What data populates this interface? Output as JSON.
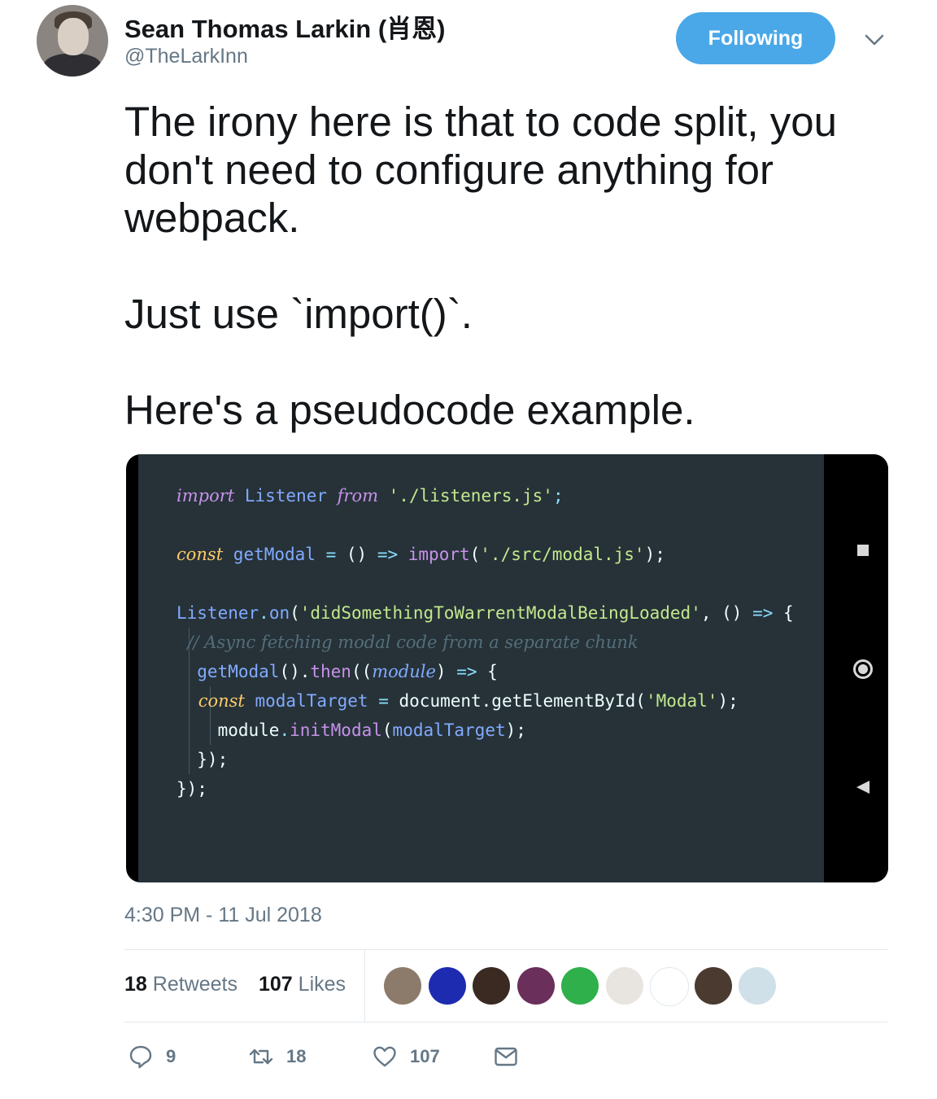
{
  "author": {
    "name": "Sean Thomas Larkin (肖恩)",
    "handle": "@TheLarkInn"
  },
  "follow_button": {
    "label": "Following",
    "color": "#4aa8e8"
  },
  "tweet": {
    "text": "The irony here is that to code split, you don't need to configure anything for webpack.\n\nJust use `import()`.\n\nHere's a pseudocode example.",
    "timestamp": "4:30 PM - 11 Jul 2018"
  },
  "code_image": {
    "lines": [
      [
        {
          "t": "import",
          "c": "kw"
        },
        {
          "t": " Listener ",
          "c": "ident"
        },
        {
          "t": "from",
          "c": "kw"
        },
        {
          "t": " './listeners.js'",
          "c": "str"
        },
        {
          "t": ";",
          "c": "op"
        }
      ],
      [],
      [
        {
          "t": "const",
          "c": "const-kw"
        },
        {
          "t": " getModal",
          "c": "fn"
        },
        {
          "t": " = ",
          "c": "op"
        },
        {
          "t": "()",
          "c": "plain"
        },
        {
          "t": " => ",
          "c": "op"
        },
        {
          "t": "import",
          "c": "mth"
        },
        {
          "t": "(",
          "c": "plain"
        },
        {
          "t": "'./src/modal.js'",
          "c": "str"
        },
        {
          "t": ");",
          "c": "plain"
        }
      ],
      [],
      [
        {
          "t": "Listener",
          "c": "ident"
        },
        {
          "t": ".",
          "c": "op"
        },
        {
          "t": "on",
          "c": "fn"
        },
        {
          "t": "(",
          "c": "plain"
        },
        {
          "t": "'didSomethingToWarrentModalBeingLoaded'",
          "c": "str"
        },
        {
          "t": ", ",
          "c": "plain"
        },
        {
          "t": "()",
          "c": "plain"
        },
        {
          "t": " => ",
          "c": "op"
        },
        {
          "t": "{",
          "c": "plain"
        }
      ],
      [
        {
          "t": "  // Async fetching modal code from a separate chunk",
          "c": "cmt"
        }
      ],
      [
        {
          "t": "  getModal",
          "c": "fn"
        },
        {
          "t": "().",
          "c": "plain"
        },
        {
          "t": "then",
          "c": "mth"
        },
        {
          "t": "((",
          "c": "plain"
        },
        {
          "t": "module",
          "c": "param"
        },
        {
          "t": ")",
          "c": "plain"
        },
        {
          "t": " => ",
          "c": "op"
        },
        {
          "t": "{",
          "c": "plain"
        }
      ],
      [
        {
          "t": "    const",
          "c": "const-kw"
        },
        {
          "t": " modalTarget",
          "c": "ident"
        },
        {
          "t": " = ",
          "c": "op"
        },
        {
          "t": "document.getElementById(",
          "c": "plain"
        },
        {
          "t": "'Modal'",
          "c": "str"
        },
        {
          "t": ");",
          "c": "plain"
        }
      ],
      [
        {
          "t": "    module",
          "c": "plain"
        },
        {
          "t": ".",
          "c": "op"
        },
        {
          "t": "initModal",
          "c": "mth"
        },
        {
          "t": "(",
          "c": "plain"
        },
        {
          "t": "modalTarget",
          "c": "ident"
        },
        {
          "t": ");",
          "c": "plain"
        }
      ],
      [
        {
          "t": "  });",
          "c": "plain"
        }
      ],
      [
        {
          "t": "});",
          "c": "plain"
        }
      ]
    ]
  },
  "stats": {
    "retweets_count": "18",
    "retweets_label": "Retweets",
    "likes_count": "107",
    "likes_label": "Likes"
  },
  "likers": [
    {
      "name": "liker-avatar-1",
      "color": "#8c7b6b"
    },
    {
      "name": "liker-avatar-2",
      "color": "#1d2bb0"
    },
    {
      "name": "liker-avatar-3",
      "color": "#3a2a22"
    },
    {
      "name": "liker-avatar-4",
      "color": "#6a2f5a"
    },
    {
      "name": "liker-avatar-5",
      "color": "#2fb04a"
    },
    {
      "name": "liker-avatar-6",
      "color": "#e8e4e0"
    },
    {
      "name": "liker-avatar-7",
      "color": "#ffffff"
    },
    {
      "name": "liker-avatar-8",
      "color": "#4a3a30"
    },
    {
      "name": "liker-avatar-9",
      "color": "#cfe0e8"
    }
  ],
  "actions": {
    "reply_count": "9",
    "retweet_count": "18",
    "like_count": "107"
  }
}
